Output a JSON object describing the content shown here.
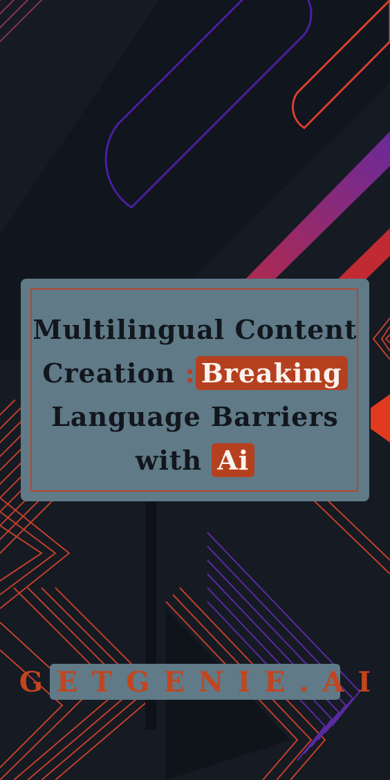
{
  "headline": {
    "line1": "Multilingual Content",
    "line2_a": "Creation",
    "line2_colon": ":",
    "line2_highlight": "Breaking",
    "line3": "Language Barriers",
    "line4_a": "with",
    "line4_highlight": "Ai"
  },
  "brand": {
    "label": "GETGENIE.AI"
  },
  "colors": {
    "background": "#151a23",
    "card": "#607a87",
    "accent": "#b5401f",
    "headline_text": "#12161d"
  }
}
